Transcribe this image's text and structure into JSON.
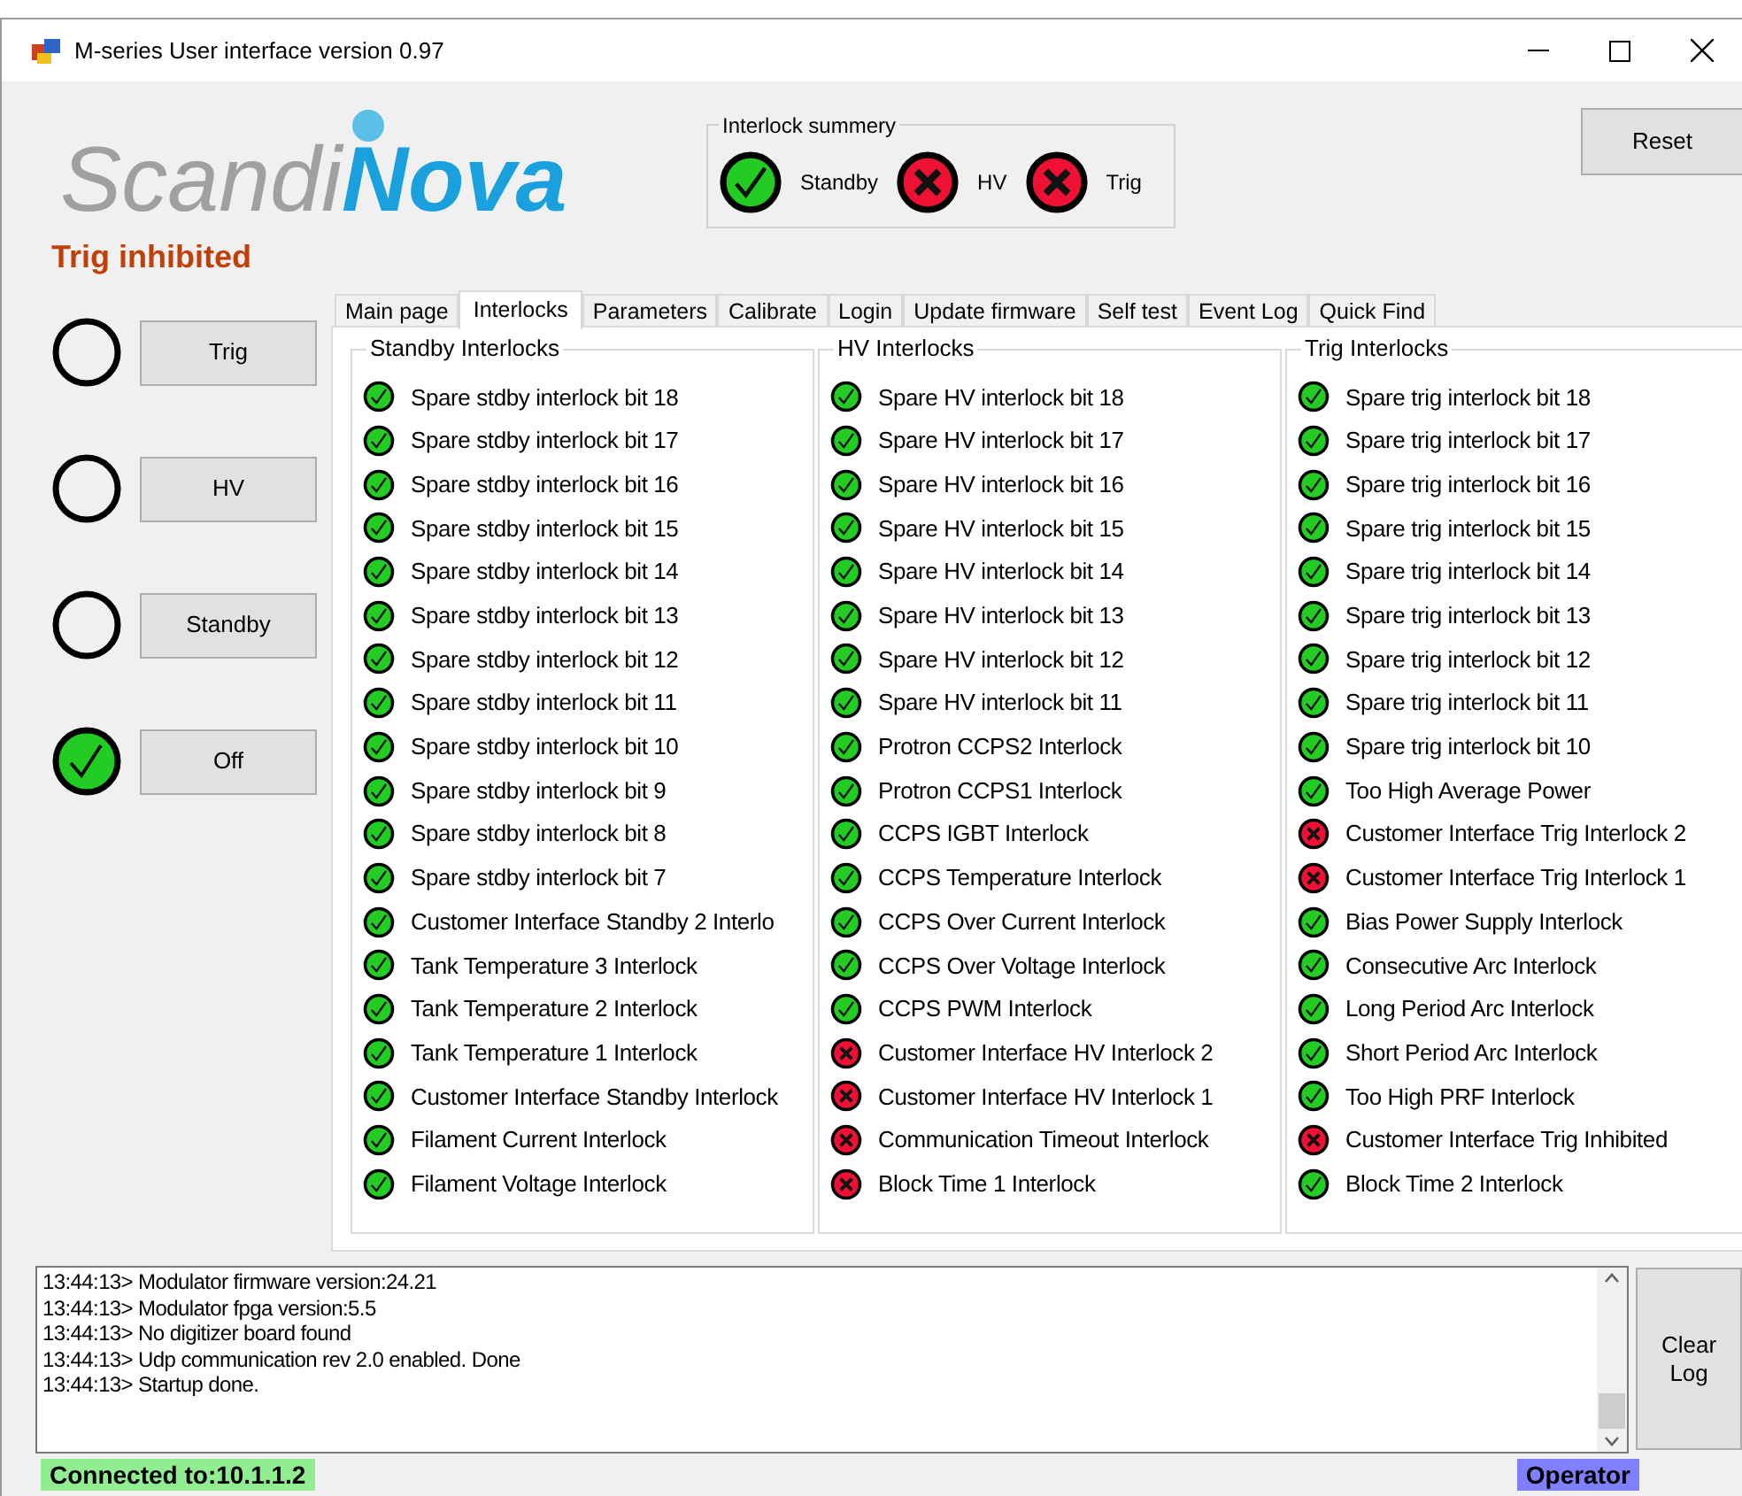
{
  "window": {
    "title": "M-series User interface version 0.97"
  },
  "logo": {
    "part_1": "Scandi",
    "part_2": "Nova"
  },
  "mode_text": "Trig inhibited",
  "interlock_summary": {
    "title": "Interlock summery",
    "items": [
      {
        "label": "Standby",
        "tripped": false
      },
      {
        "label": "HV",
        "tripped": true
      },
      {
        "label": "Trig",
        "tripped": true
      }
    ]
  },
  "reset_button": "Reset",
  "state_controls": [
    {
      "label": "Trig",
      "lit": false
    },
    {
      "label": "HV",
      "lit": false
    },
    {
      "label": "Standby",
      "lit": false
    },
    {
      "label": "Off",
      "lit": true
    }
  ],
  "tabs": [
    {
      "label": "Main page",
      "selected": false
    },
    {
      "label": "Interlocks",
      "selected": true
    },
    {
      "label": "Parameters",
      "selected": false
    },
    {
      "label": "Calibrate",
      "selected": false
    },
    {
      "label": "Login",
      "selected": false
    },
    {
      "label": "Update firmware",
      "selected": false
    },
    {
      "label": "Self test",
      "selected": false
    },
    {
      "label": "Event Log",
      "selected": false
    },
    {
      "label": "Quick Find",
      "selected": false
    }
  ],
  "groups": [
    {
      "title": "Standby Interlocks",
      "items": [
        {
          "label": "Spare stdby interlock bit 18",
          "tripped": false
        },
        {
          "label": "Spare stdby interlock bit 17",
          "tripped": false
        },
        {
          "label": "Spare stdby interlock bit 16",
          "tripped": false
        },
        {
          "label": "Spare stdby interlock bit 15",
          "tripped": false
        },
        {
          "label": "Spare stdby interlock bit 14",
          "tripped": false
        },
        {
          "label": "Spare stdby interlock bit 13",
          "tripped": false
        },
        {
          "label": "Spare stdby interlock bit 12",
          "tripped": false
        },
        {
          "label": "Spare stdby interlock bit 11",
          "tripped": false
        },
        {
          "label": "Spare stdby interlock bit 10",
          "tripped": false
        },
        {
          "label": "Spare stdby interlock bit 9",
          "tripped": false
        },
        {
          "label": "Spare stdby interlock bit 8",
          "tripped": false
        },
        {
          "label": "Spare stdby interlock bit 7",
          "tripped": false
        },
        {
          "label": "Customer Interface Standby 2 Interlo",
          "tripped": false
        },
        {
          "label": "Tank Temperature 3 Interlock",
          "tripped": false
        },
        {
          "label": "Tank Temperature 2 Interlock",
          "tripped": false
        },
        {
          "label": "Tank Temperature 1 Interlock",
          "tripped": false
        },
        {
          "label": "Customer Interface Standby Interlock",
          "tripped": false
        },
        {
          "label": "Filament Current Interlock",
          "tripped": false
        },
        {
          "label": "Filament Voltage Interlock",
          "tripped": false
        }
      ]
    },
    {
      "title": "HV Interlocks",
      "items": [
        {
          "label": "Spare HV interlock bit 18",
          "tripped": false
        },
        {
          "label": "Spare HV interlock bit 17",
          "tripped": false
        },
        {
          "label": "Spare HV interlock bit 16",
          "tripped": false
        },
        {
          "label": "Spare HV interlock bit 15",
          "tripped": false
        },
        {
          "label": "Spare HV interlock bit 14",
          "tripped": false
        },
        {
          "label": "Spare HV interlock bit 13",
          "tripped": false
        },
        {
          "label": "Spare HV interlock bit 12",
          "tripped": false
        },
        {
          "label": "Spare HV interlock bit 11",
          "tripped": false
        },
        {
          "label": "Protron CCPS2 Interlock",
          "tripped": false
        },
        {
          "label": "Protron CCPS1 Interlock",
          "tripped": false
        },
        {
          "label": "CCPS IGBT Interlock",
          "tripped": false
        },
        {
          "label": "CCPS Temperature Interlock",
          "tripped": false
        },
        {
          "label": "CCPS Over Current Interlock",
          "tripped": false
        },
        {
          "label": "CCPS Over Voltage Interlock",
          "tripped": false
        },
        {
          "label": "CCPS PWM Interlock",
          "tripped": false
        },
        {
          "label": "Customer Interface HV Interlock 2",
          "tripped": true
        },
        {
          "label": "Customer Interface HV Interlock 1",
          "tripped": true
        },
        {
          "label": "Communication Timeout Interlock",
          "tripped": true
        },
        {
          "label": "Block Time 1 Interlock",
          "tripped": true
        }
      ]
    },
    {
      "title": "Trig Interlocks",
      "items": [
        {
          "label": "Spare trig interlock bit 18",
          "tripped": false
        },
        {
          "label": "Spare trig interlock bit 17",
          "tripped": false
        },
        {
          "label": "Spare trig interlock bit 16",
          "tripped": false
        },
        {
          "label": "Spare trig interlock bit 15",
          "tripped": false
        },
        {
          "label": "Spare trig interlock bit 14",
          "tripped": false
        },
        {
          "label": "Spare trig interlock bit 13",
          "tripped": false
        },
        {
          "label": "Spare trig interlock bit 12",
          "tripped": false
        },
        {
          "label": "Spare trig interlock bit 11",
          "tripped": false
        },
        {
          "label": "Spare trig interlock bit 10",
          "tripped": false
        },
        {
          "label": "Too High Average Power",
          "tripped": false
        },
        {
          "label": "Customer Interface Trig Interlock 2",
          "tripped": true
        },
        {
          "label": "Customer Interface Trig Interlock 1",
          "tripped": true
        },
        {
          "label": "Bias Power Supply Interlock",
          "tripped": false
        },
        {
          "label": "Consecutive Arc Interlock",
          "tripped": false
        },
        {
          "label": "Long Period Arc Interlock",
          "tripped": false
        },
        {
          "label": "Short Period Arc Interlock",
          "tripped": false
        },
        {
          "label": "Too High PRF Interlock",
          "tripped": false
        },
        {
          "label": "Customer Interface Trig Inhibited",
          "tripped": true
        },
        {
          "label": "Block Time 2 Interlock",
          "tripped": false
        }
      ]
    }
  ],
  "log": {
    "lines": [
      "13:44:13> Modulator firmware version:24.21",
      "13:44:13> Modulator fpga version:5.5",
      "13:44:13> No digitizer board found",
      "13:44:13> Udp communication rev 2.0 enabled. Done",
      "13:44:13> Startup done."
    ]
  },
  "clear_log_button": "Clear Log",
  "status_bar": {
    "connection": "Connected to:10.1.1.2",
    "role": "Operator"
  }
}
